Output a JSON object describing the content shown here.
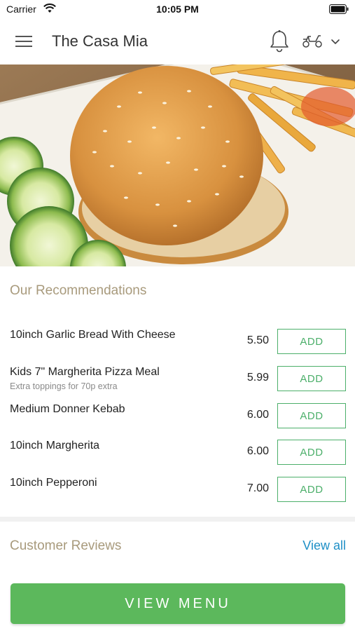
{
  "status_bar": {
    "carrier": "Carrier",
    "time": "10:05 PM"
  },
  "header": {
    "title": "The Casa Mia"
  },
  "recommendations": {
    "title": "Our Recommendations",
    "items": [
      {
        "name": "10inch Garlic Bread With Cheese",
        "note": "",
        "price": "5.50",
        "add_label": "ADD"
      },
      {
        "name": "Kids 7\" Margherita Pizza Meal",
        "note": "Extra toppings for 70p extra",
        "price": "5.99",
        "add_label": "ADD"
      },
      {
        "name": "Medium Donner Kebab",
        "note": "",
        "price": "6.00",
        "add_label": "ADD"
      },
      {
        "name": "10inch Margherita",
        "note": "",
        "price": "6.00",
        "add_label": "ADD"
      },
      {
        "name": "10inch Pepperoni",
        "note": "",
        "price": "7.00",
        "add_label": "ADD"
      }
    ]
  },
  "reviews": {
    "title": "Customer Reviews",
    "view_all": "View all"
  },
  "footer": {
    "view_menu": "VIEW MENU"
  },
  "colors": {
    "accent_green": "#5cb85c",
    "section_title": "#a89a7c",
    "link_blue": "#1e8fc6"
  }
}
